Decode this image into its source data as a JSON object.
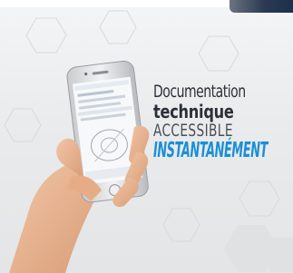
{
  "tagline": {
    "line1": "Documentation",
    "line2": "technique",
    "line3": "ACCESSIBLE",
    "line4": "INSTANTANÉMENT"
  },
  "colors": {
    "background": "#e8eaeb",
    "text_dark": "#2b3038",
    "accent_blue": "#1a8fd6",
    "phone_body": "#d9dadc",
    "skin": "#e9b48f"
  },
  "phone_screen": {
    "items": [
      "",
      "",
      "",
      "",
      ""
    ]
  }
}
